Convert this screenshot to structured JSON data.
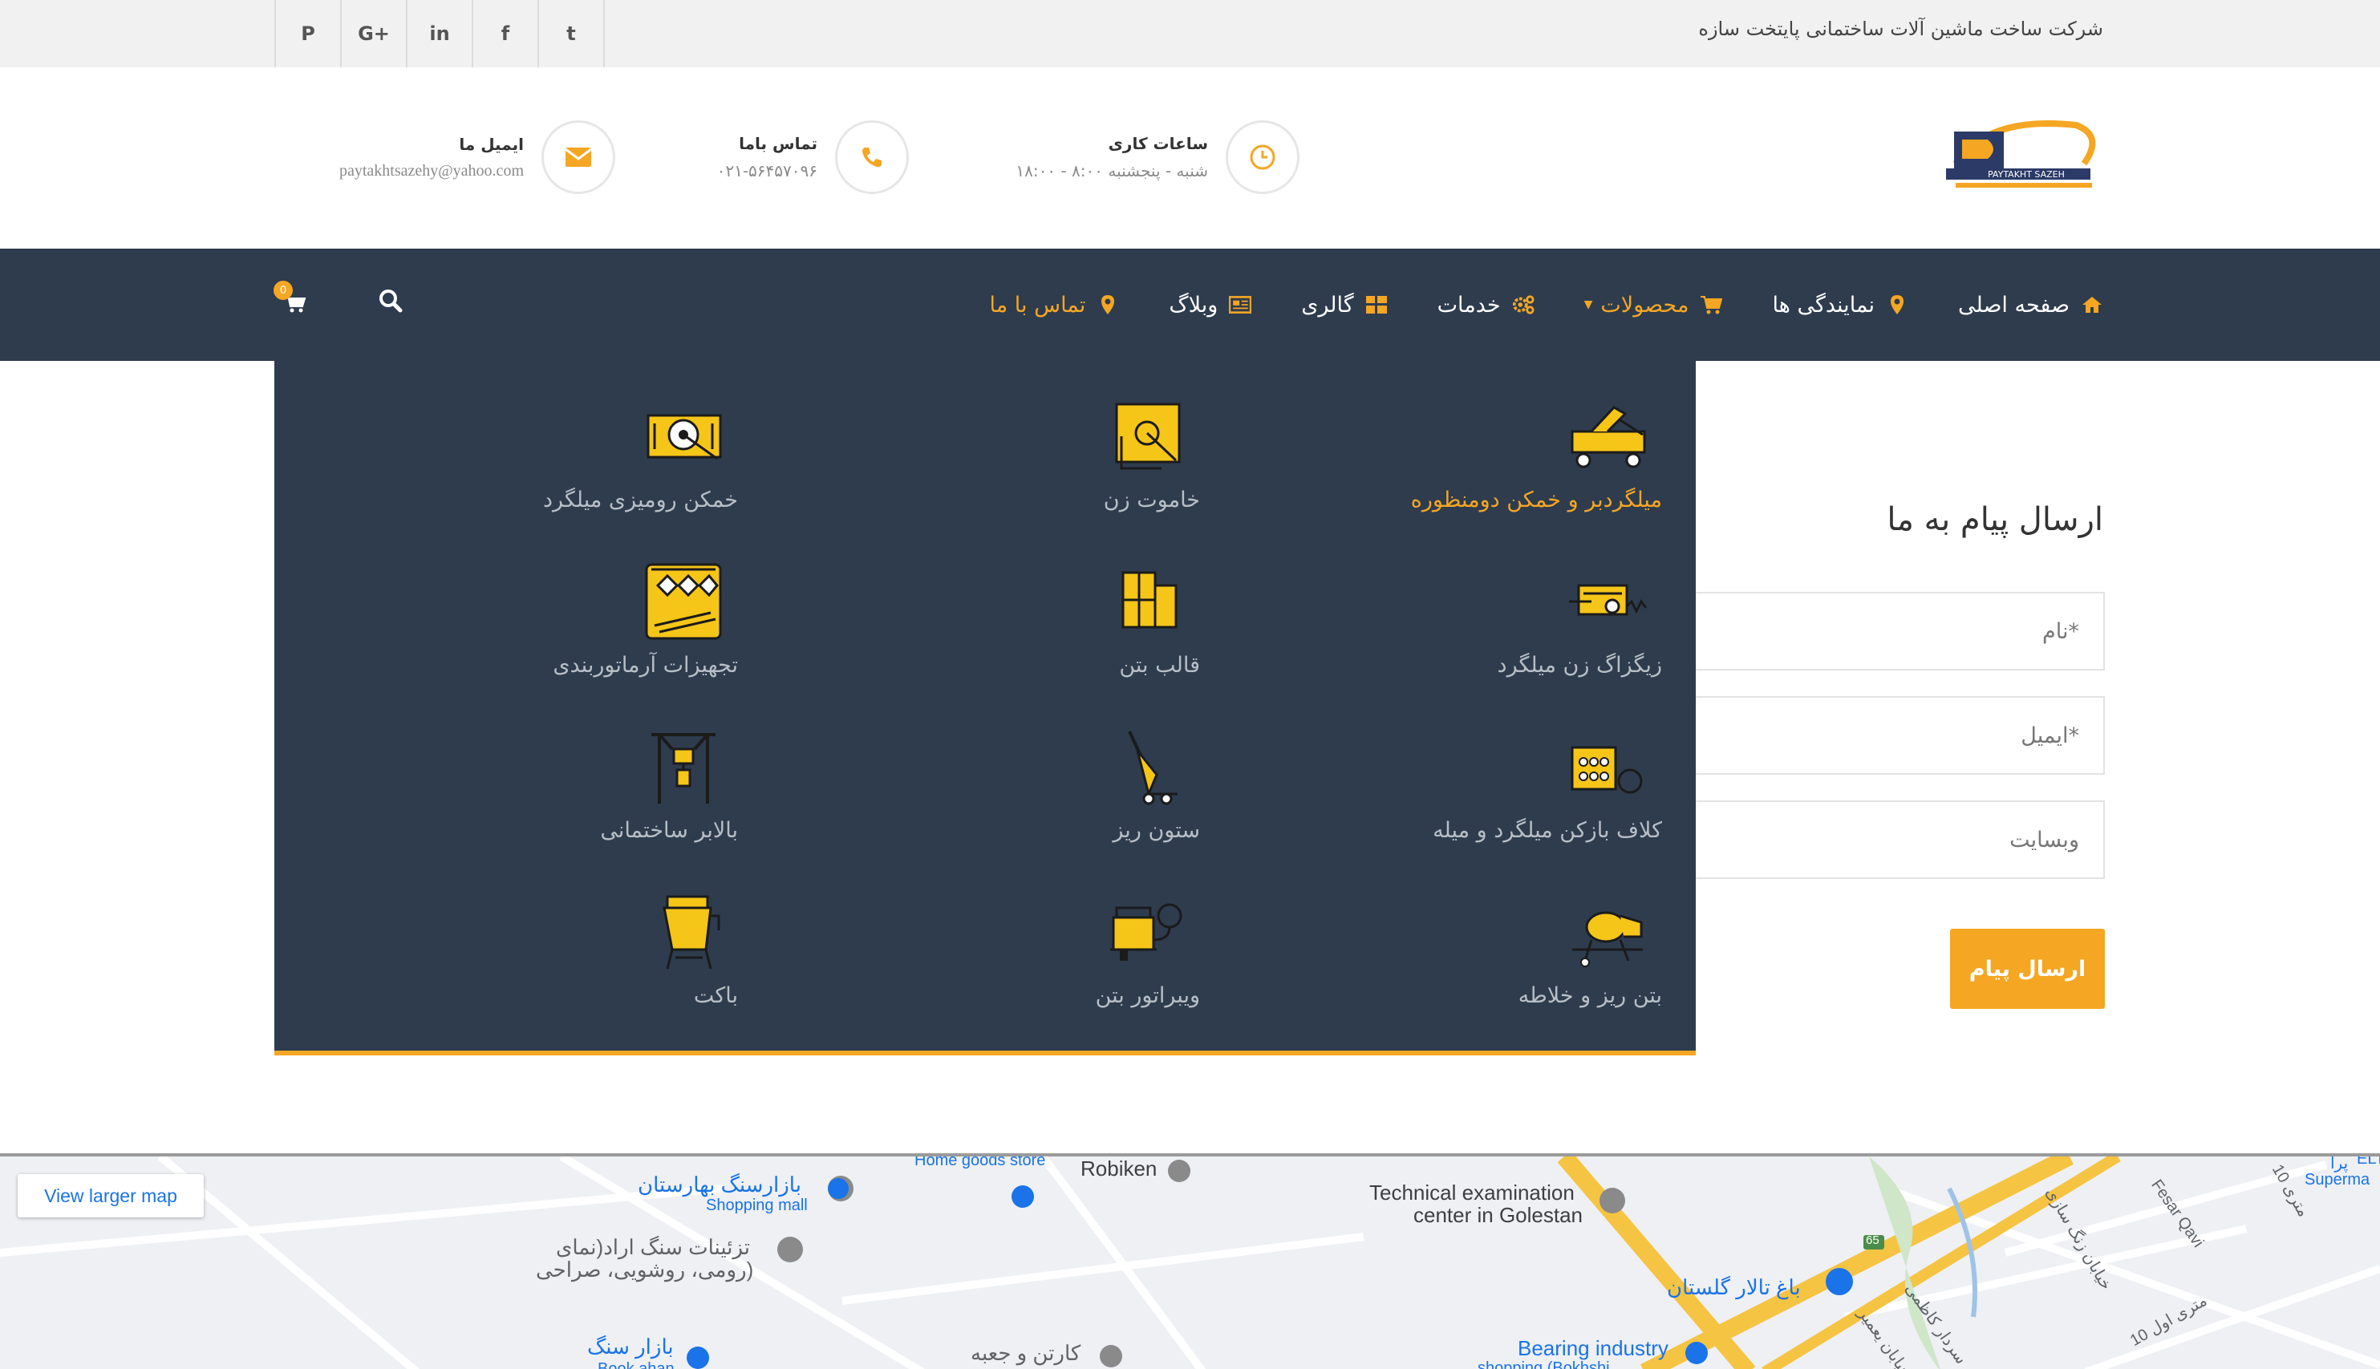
{
  "topbar": {
    "company_name": "شرکت ساخت ماشین آلات ساختمانی پایتخت سازه",
    "social_icons": [
      "twitter-icon",
      "facebook-icon",
      "linkedin-icon",
      "google-plus-icon",
      "pinterest-icon"
    ],
    "social_glyphs": {
      "twitter": "t",
      "facebook": "f",
      "linkedin": "in",
      "googleplus": "G+",
      "pinterest": "P"
    }
  },
  "header": {
    "logo_text": "PAYTAKHT SAZEH",
    "hours": {
      "title": "ساعات کاری",
      "value": "شنبه - پنجشنبه ۸:۰۰ - ۱۸:۰۰"
    },
    "phone": {
      "title": "تماس باما",
      "value": "۰۲۱-۵۶۴۵۷۰۹۶"
    },
    "email": {
      "title": "ایمیل ما",
      "value": "paytakhtsazehy@yahoo.com"
    }
  },
  "nav": {
    "items": [
      {
        "label": "صفحه اصلی",
        "icon": "home-icon"
      },
      {
        "label": "نمایندگی ها",
        "icon": "map-marker-icon"
      },
      {
        "label": "محصولات",
        "icon": "cart-icon",
        "active": true
      },
      {
        "label": "خدمات",
        "icon": "gears-icon"
      },
      {
        "label": "گالری",
        "icon": "grid-icon"
      },
      {
        "label": "وبلاگ",
        "icon": "newspaper-icon"
      },
      {
        "label": "تماس با ما",
        "icon": "map-marker-icon",
        "active": true
      }
    ],
    "cart_count": "0"
  },
  "mega_menu": {
    "items": [
      {
        "label": "میلگردبر و خمکن دومنظوره",
        "icon": "rebar-cutter-bender-icon",
        "active": true
      },
      {
        "label": "خاموت زن",
        "icon": "stirrup-bender-icon"
      },
      {
        "label": "خمکن رومیزی میلگرد",
        "icon": "bench-rebar-bender-icon"
      },
      {
        "label": "زیگزاگ زن میلگرد",
        "icon": "zigzag-machine-icon"
      },
      {
        "label": "قالب بتن",
        "icon": "concrete-formwork-icon"
      },
      {
        "label": "تجهیزات آرماتوربندی",
        "icon": "rebar-tools-icon"
      },
      {
        "label": "کلاف بازکن میلگرد و میله",
        "icon": "coil-decoiler-icon"
      },
      {
        "label": "ستون ریز",
        "icon": "column-pourer-icon"
      },
      {
        "label": "بالابر ساختمانی",
        "icon": "construction-hoist-icon"
      },
      {
        "label": "بتن ریز و خلاطه",
        "icon": "concrete-mixer-icon"
      },
      {
        "label": "ویبراتور بتن",
        "icon": "concrete-vibrator-icon"
      },
      {
        "label": "باکت",
        "icon": "bucket-icon"
      }
    ]
  },
  "contact_form": {
    "title": "ارسال پیام به ما",
    "name_placeholder": "*نام",
    "email_placeholder": "*ایمیل",
    "website_placeholder": "وبسایت",
    "submit_label": "ارسال پیام"
  },
  "map": {
    "view_larger": "View larger map",
    "labels": [
      "Home goods store",
      "Robiken",
      "Technical examination",
      "center in Golestan",
      "بازارسنگ بهارستان",
      "Shopping mall",
      "تزئینات سنگ اراد(نمای",
      "رومی، روشویی، صراحی)",
      "بازار سنگ",
      "Book ahan",
      "کارتن و جعبه",
      "باغ تالار گلستان",
      "Bearing industry",
      "shopping (Bokhshi",
      "65",
      "Fesar Qavi",
      "10 متری اول",
      "10 متری",
      "Superma",
      "پرا",
      "ELT",
      "خیابان زنگ سازی",
      "سردار کاظمی",
      "خیابان یعمیر"
    ]
  }
}
